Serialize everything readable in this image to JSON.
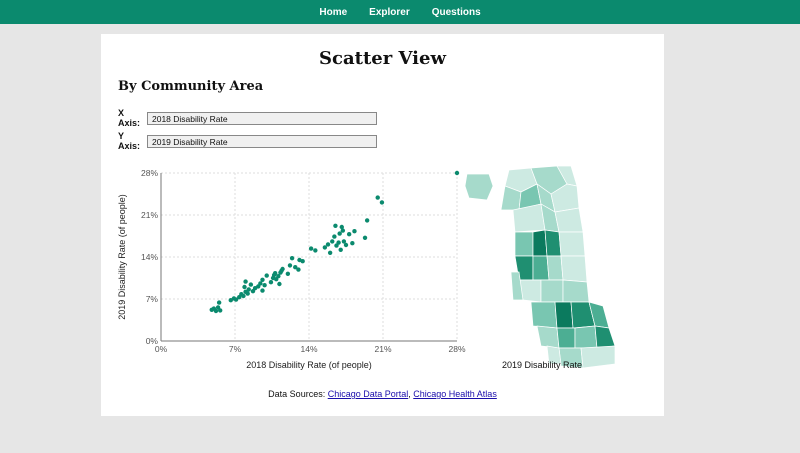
{
  "nav": {
    "items": [
      "Home",
      "Explorer",
      "Questions"
    ]
  },
  "page": {
    "title": "Scatter View",
    "subtitle": "By Community Area"
  },
  "controls": {
    "x_label": "X Axis:",
    "x_value": "2018 Disability Rate",
    "y_label": "Y Axis:",
    "y_value": "2019 Disability Rate"
  },
  "map": {
    "caption": "2019 Disability Rate",
    "colors": [
      "#cdeae2",
      "#a6dacb",
      "#79c6b1",
      "#4cae93",
      "#1f8f71",
      "#0b7a5e"
    ]
  },
  "sources": {
    "prefix": "Data Sources: ",
    "link1": "Chicago Data Portal",
    "sep": ", ",
    "link2": "Chicago Health Atlas"
  },
  "chart_data": {
    "type": "scatter",
    "xlabel": "2018 Disability Rate (of people)",
    "ylabel": "2019 Disability Rate (of people)",
    "xlim": [
      0,
      28
    ],
    "ylim": [
      0,
      28
    ],
    "x_ticks": [
      "0%",
      "7%",
      "14%",
      "21%",
      "28%"
    ],
    "y_ticks": [
      "0%",
      "7%",
      "14%",
      "21%",
      "28%"
    ],
    "grid": true,
    "color": "#0b8a6e",
    "points": [
      [
        4.8,
        5.2
      ],
      [
        5.0,
        5.4
      ],
      [
        5.2,
        5.0
      ],
      [
        5.4,
        5.6
      ],
      [
        5.5,
        6.4
      ],
      [
        5.6,
        5.1
      ],
      [
        6.6,
        6.8
      ],
      [
        6.9,
        7.1
      ],
      [
        7.1,
        6.9
      ],
      [
        7.4,
        7.3
      ],
      [
        7.6,
        7.8
      ],
      [
        7.8,
        7.5
      ],
      [
        8.0,
        8.2
      ],
      [
        8.2,
        7.9
      ],
      [
        8.3,
        8.6
      ],
      [
        8.5,
        9.4
      ],
      [
        8.7,
        8.3
      ],
      [
        8.9,
        8.8
      ],
      [
        7.9,
        9.0
      ],
      [
        8.0,
        9.9
      ],
      [
        9.2,
        9.1
      ],
      [
        9.4,
        9.6
      ],
      [
        9.6,
        10.2
      ],
      [
        9.8,
        9.3
      ],
      [
        10.0,
        10.9
      ],
      [
        9.6,
        8.4
      ],
      [
        10.4,
        9.8
      ],
      [
        10.6,
        10.5
      ],
      [
        10.7,
        11.0
      ],
      [
        10.9,
        10.3
      ],
      [
        11.1,
        10.8
      ],
      [
        11.3,
        11.4
      ],
      [
        11.5,
        12.0
      ],
      [
        11.2,
        9.5
      ],
      [
        10.8,
        11.3
      ],
      [
        11.4,
        11.7
      ],
      [
        12.2,
        12.6
      ],
      [
        12.4,
        13.8
      ],
      [
        12.7,
        12.3
      ],
      [
        13.1,
        13.5
      ],
      [
        13.4,
        13.3
      ],
      [
        13.0,
        11.9
      ],
      [
        12.0,
        11.2
      ],
      [
        14.2,
        15.4
      ],
      [
        14.6,
        15.1
      ],
      [
        15.5,
        15.6
      ],
      [
        15.8,
        16.1
      ],
      [
        16.0,
        14.7
      ],
      [
        16.2,
        16.6
      ],
      [
        16.4,
        17.4
      ],
      [
        16.6,
        15.9
      ],
      [
        16.8,
        16.4
      ],
      [
        17.0,
        15.2
      ],
      [
        17.3,
        16.6
      ],
      [
        17.5,
        16.0
      ],
      [
        17.8,
        17.8
      ],
      [
        18.1,
        16.3
      ],
      [
        18.3,
        18.3
      ],
      [
        16.9,
        17.9
      ],
      [
        17.2,
        18.4
      ],
      [
        16.5,
        19.2
      ],
      [
        17.1,
        19.0
      ],
      [
        19.3,
        17.2
      ],
      [
        19.5,
        20.1
      ],
      [
        20.5,
        23.9
      ],
      [
        20.9,
        23.1
      ],
      [
        28.0,
        28.0
      ]
    ]
  }
}
